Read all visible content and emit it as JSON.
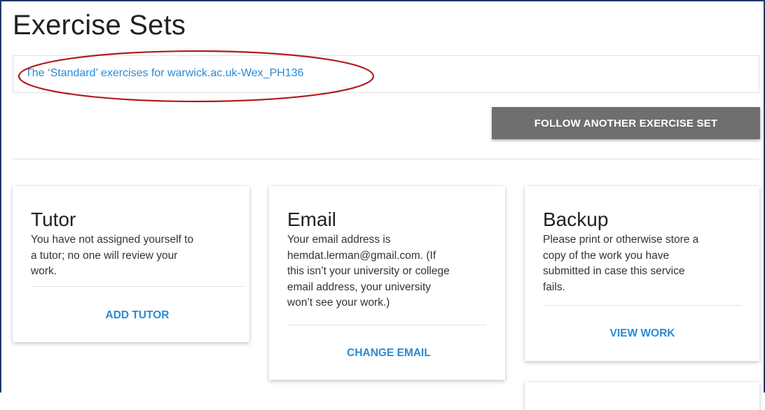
{
  "page": {
    "title": "Exercise Sets"
  },
  "exercise_set": {
    "link_text": "The ‘Standard’ exercises for warwick.ac.uk-Wex_PH136"
  },
  "buttons": {
    "follow_another": "FOLLOW ANOTHER EXERCISE SET"
  },
  "cards": {
    "tutor": {
      "title": "Tutor",
      "text": "You have not assigned yourself to\na tutor; no one will review your\nwork.",
      "action": "ADD TUTOR"
    },
    "email": {
      "title": "Email",
      "text": "Your email address is\nhemdat.lerman@gmail.com. (If\nthis isn’t your university or college\nemail address, your university\nwon’t see your work.)",
      "action": "CHANGE EMAIL"
    },
    "backup": {
      "title": "Backup",
      "text": "Please print or otherwise store a\ncopy of the work you have\nsubmitted in case this service\nfails.",
      "action": "VIEW WORK"
    }
  },
  "colors": {
    "link": "#2a8ad4",
    "annotation_ellipse": "#b01c1c",
    "button_bg": "#6f6f6f",
    "frame": "#1f3b66"
  }
}
